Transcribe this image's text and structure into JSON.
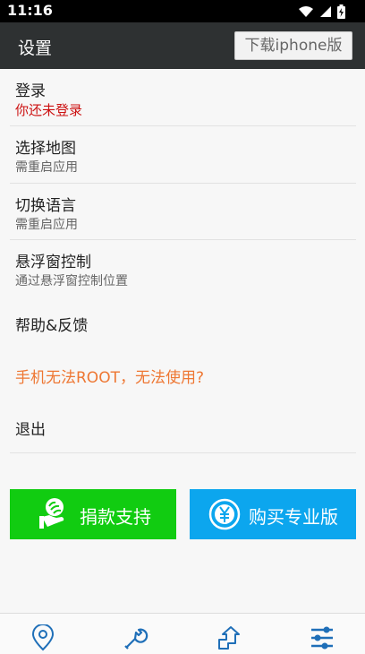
{
  "status_bar": {
    "time": "11:16",
    "icons": [
      "wifi-icon",
      "signal-icon",
      "battery-icon"
    ]
  },
  "app_bar": {
    "title": "设置",
    "download_label": "下载iphone版"
  },
  "settings": {
    "items": [
      {
        "title": "登录",
        "subtitle": "你还未登录"
      },
      {
        "title": "选择地图",
        "subtitle": "需重启应用"
      },
      {
        "title": "切换语言",
        "subtitle": "需重启应用"
      },
      {
        "title": "悬浮窗控制",
        "subtitle": "通过悬浮窗控制位置"
      },
      {
        "title": "帮助&反馈"
      },
      {
        "title": "手机无法ROOT，无法使用?"
      },
      {
        "title": "退出"
      }
    ]
  },
  "actions": {
    "donate_label": "捐款支持",
    "buy_label": "购买专业版"
  },
  "bottom_nav": {
    "items": [
      "location-pin-icon",
      "wrench-icon",
      "share-arrow-icon",
      "settings-sliders-icon"
    ]
  },
  "colors": {
    "app_bar": "#2e3132",
    "warning_text": "#cc1111",
    "orange_text": "#ee7733",
    "donate_green": "#11cc11",
    "buy_blue": "#0ca6ee",
    "nav_blue": "#1f6fb8"
  }
}
